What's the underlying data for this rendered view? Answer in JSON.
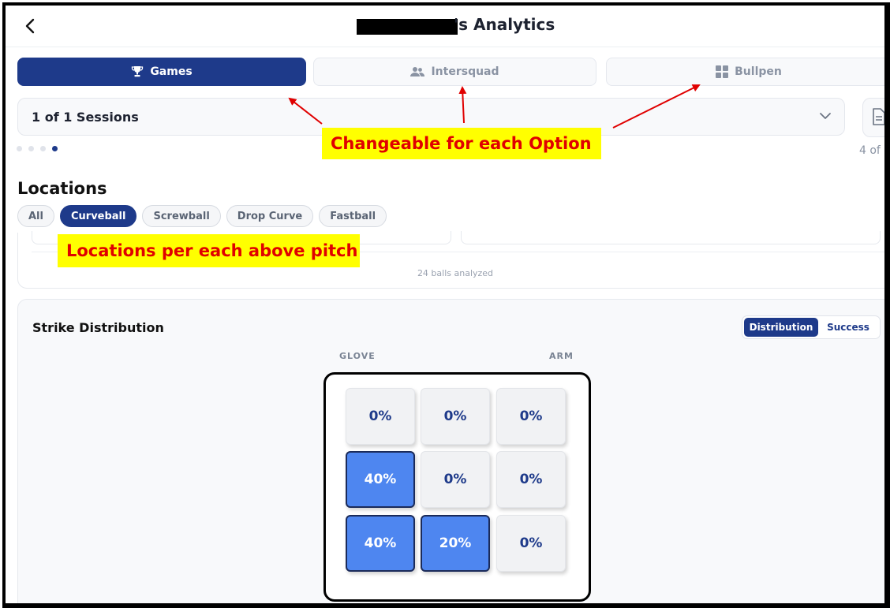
{
  "header": {
    "title": "'s Analytics"
  },
  "tabs": [
    {
      "label": "Games",
      "icon": "trophy-icon",
      "active": true
    },
    {
      "label": "Intersquad",
      "icon": "users-icon",
      "active": false
    },
    {
      "label": "Bullpen",
      "icon": "grid-icon",
      "active": false
    }
  ],
  "session": {
    "label": "1 of 1 Sessions",
    "page_indicator": "4 of",
    "dots_active_index": 3
  },
  "locations": {
    "title": "Locations",
    "pitch_filters": [
      "All",
      "Curveball",
      "Screwball",
      "Drop Curve",
      "Fastball"
    ],
    "active_filter": "Curveball",
    "balls_analyzed": "24 balls analyzed"
  },
  "strike_distribution": {
    "title": "Strike Distribution",
    "toggle": {
      "options": [
        "Distribution",
        "Success"
      ],
      "selected": "Distribution"
    },
    "glove_label": "GLOVE",
    "arm_label": "ARM",
    "zones": [
      [
        "0%",
        "0%",
        "0%"
      ],
      [
        "40%",
        "0%",
        "0%"
      ],
      [
        "40%",
        "20%",
        "0%"
      ]
    ]
  },
  "annotations": {
    "callout_option": "Changeable for each Option",
    "callout_pitch": "Locations per each above pitch"
  },
  "colors": {
    "primary": "#1e3a8a",
    "highlight_zone": "#4e86f0",
    "annotation_bg": "#ffff00",
    "annotation_text": "#e00000"
  }
}
